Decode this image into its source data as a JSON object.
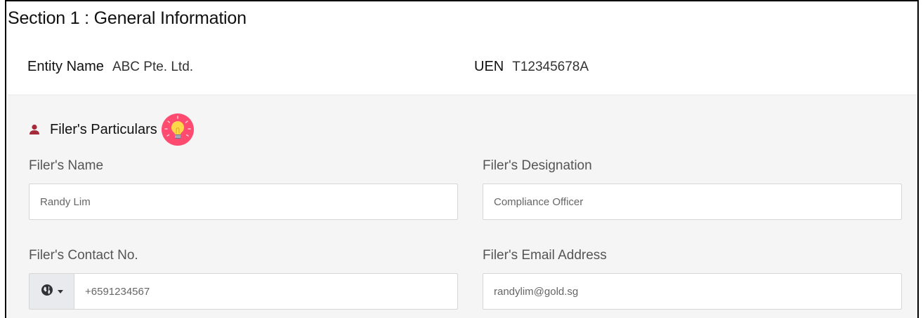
{
  "section": {
    "title": "Section 1 : General Information"
  },
  "entity": {
    "name_label": "Entity Name",
    "name_value": "ABC Pte. Ltd.",
    "uen_label": "UEN",
    "uen_value": "T12345678A"
  },
  "filer": {
    "heading": "Filer's Particulars",
    "name": {
      "label": "Filer's Name",
      "value": "Randy Lim"
    },
    "designation": {
      "label": "Filer's Designation",
      "value": "Compliance Officer"
    },
    "contact": {
      "label": "Filer's Contact No.",
      "value": "+6591234567",
      "prefix_icon": "globe-icon"
    },
    "email": {
      "label": "Filer's Email Address",
      "value": "randylim@gold.sg"
    }
  },
  "colors": {
    "accent_user_icon": "#a52a3a",
    "bulb_badge": "#ff4b70",
    "panel_bg": "#f5f5f5"
  }
}
